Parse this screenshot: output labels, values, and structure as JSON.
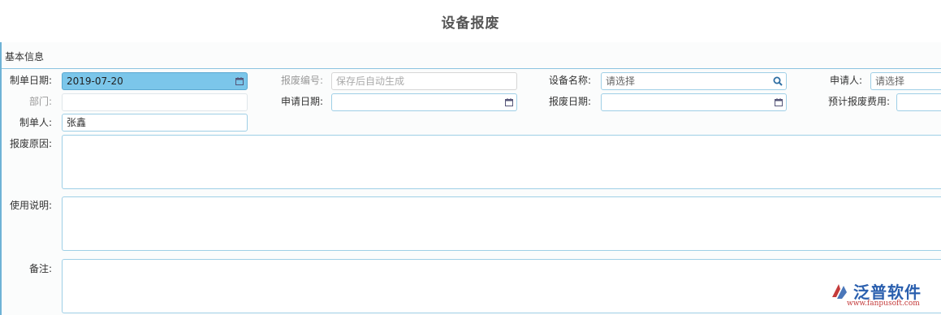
{
  "page": {
    "title": "设备报废"
  },
  "section": {
    "basic_info": "基本信息"
  },
  "fields": {
    "made_date": {
      "label": "制单日期:",
      "value": "2019-07-20"
    },
    "scrap_no": {
      "label": "报废编号:",
      "placeholder": "保存后自动生成"
    },
    "device_name": {
      "label": "设备名称:",
      "placeholder": "请选择"
    },
    "applicant": {
      "label": "申请人:",
      "placeholder": "请选择"
    },
    "department": {
      "label": "部门:",
      "value": ""
    },
    "apply_date": {
      "label": "申请日期:",
      "value": ""
    },
    "scrap_date": {
      "label": "报废日期:",
      "value": ""
    },
    "est_cost": {
      "label": "预计报废费用:",
      "value": ""
    },
    "maker": {
      "label": "制单人:",
      "value": "张鑫"
    },
    "reason": {
      "label": "报废原因:"
    },
    "usage": {
      "label": "使用说明:"
    },
    "remark": {
      "label": "备注:"
    }
  },
  "watermark": {
    "brand": "泛普软件",
    "url": "www.fanpusoft.com"
  },
  "colors": {
    "accent": "#7bc6ea",
    "border": "#9fcfe6",
    "brand": "#2a5fae"
  }
}
